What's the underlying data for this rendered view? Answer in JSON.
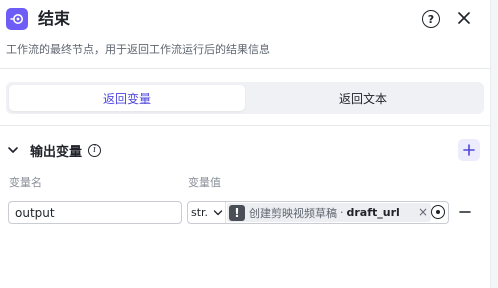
{
  "header": {
    "title": "结束",
    "icon": "end-node-icon",
    "accent": "#6d5cf6"
  },
  "description": "工作流的最终节点，用于返回工作流运行后的结果信息",
  "tabs": [
    {
      "label": "返回变量",
      "active": true
    },
    {
      "label": "返回文本",
      "active": false
    }
  ],
  "output_section": {
    "title": "输出变量",
    "name_label": "变量名",
    "value_label": "变量值"
  },
  "rows": [
    {
      "name": "output",
      "type": "str.",
      "ref_node": "创建剪映视频草稿",
      "ref_separator": "·",
      "ref_var": "draft_url",
      "clear_symbol": "×"
    }
  ]
}
